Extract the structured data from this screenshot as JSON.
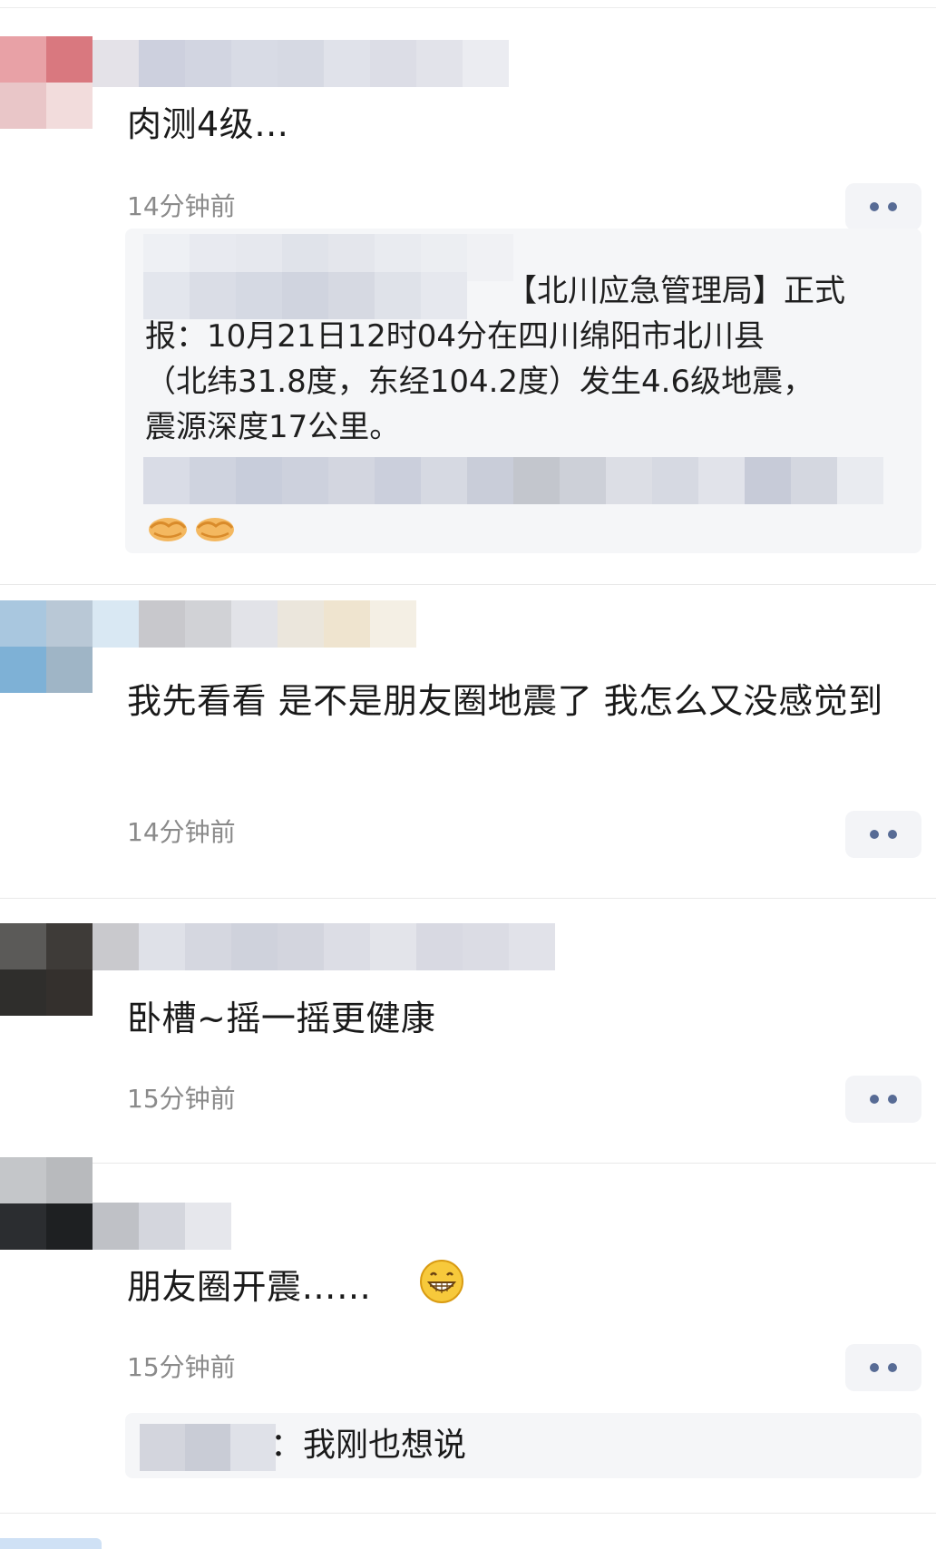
{
  "comments": [
    {
      "text": "肉测4级…",
      "time": "14分钟前",
      "quote": {
        "lines": [
          "【北川应急管理局】正式",
          "报：10月21日12时04分在四川绵阳市北川县",
          "（北纬31.8度，东经104.2度）发生4.6级地震，",
          "震源深度17公里。"
        ],
        "emoji_name": "handshake-emoji"
      }
    },
    {
      "text": "我先看看 是不是朋友圈地震了 我怎么又没感觉到",
      "time": "14分钟前"
    },
    {
      "text": "卧槽~摇一摇更健康",
      "time": "15分钟前"
    },
    {
      "text": "朋友圈开震……",
      "time": "15分钟前",
      "emoji_name": "grinning-face-emoji",
      "reply": {
        "text": "：我刚也想说"
      }
    }
  ],
  "icons": {
    "more": "more-dots-icon"
  },
  "colors": {
    "link_blue": "#576b95",
    "timestamp_gray": "#8a8a8a",
    "quote_bg": "#f5f6f8"
  }
}
